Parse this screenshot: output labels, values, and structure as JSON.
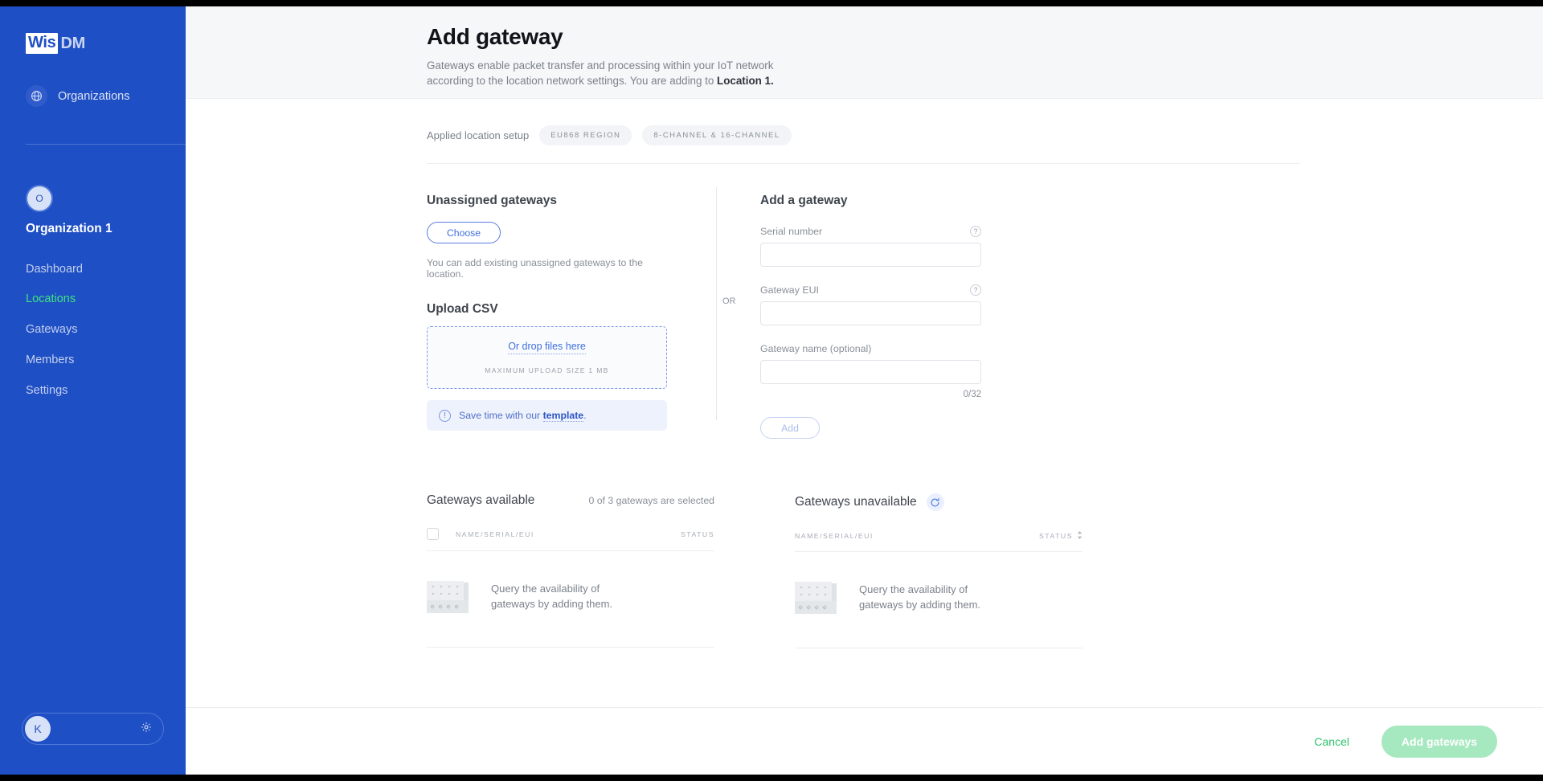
{
  "sidebar": {
    "logo_first": "Wis",
    "logo_second": "DM",
    "organizations_label": "Organizations",
    "org_avatar_initial": "O",
    "org_name": "Organization 1",
    "nav": [
      {
        "label": "Dashboard",
        "active": false
      },
      {
        "label": "Locations",
        "active": true
      },
      {
        "label": "Gateways",
        "active": false
      },
      {
        "label": "Members",
        "active": false
      },
      {
        "label": "Settings",
        "active": false
      }
    ],
    "user_initial": "K",
    "accent_blue": "#1f4fc4",
    "active_green": "#3ee37e"
  },
  "header": {
    "title": "Add gateway",
    "subtitle_part1": "Gateways enable packet transfer and processing within your IoT network according to the location network settings. You are adding to ",
    "subtitle_bold": "Location 1."
  },
  "setup": {
    "label": "Applied location setup",
    "chips": [
      "EU868 REGION",
      "8-CHANNEL & 16-CHANNEL"
    ]
  },
  "unassigned": {
    "title": "Unassigned gateways",
    "choose_label": "Choose",
    "help": "You can add existing unassigned gateways to the location.",
    "upload_title": "Upload CSV",
    "drop_link": "Or drop files here",
    "drop_max": "MAXIMUM UPLOAD SIZE 1 MB",
    "template_prefix": "Save time with our ",
    "template_link": "template",
    "template_suffix": "."
  },
  "divider": {
    "or_label": "OR"
  },
  "addform": {
    "title": "Add a gateway",
    "serial_label": "Serial number",
    "serial_value": "",
    "eui_label": "Gateway EUI",
    "eui_value": "",
    "name_label": "Gateway name (optional)",
    "name_value": "",
    "counter": "0/32",
    "add_label": "Add",
    "help_glyph": "?"
  },
  "available": {
    "title": "Gateways available",
    "selection": "0 of 3 gateways are selected",
    "col_name": "NAME/SERIAL/EUI",
    "col_status": "STATUS",
    "empty_text": "Query the availability of gateways by adding them."
  },
  "unavailable": {
    "title": "Gateways unavailable",
    "col_name": "NAME/SERIAL/EUI",
    "col_status": "STATUS",
    "empty_text": "Query the availability of gateways by adding them."
  },
  "footer": {
    "cancel_label": "Cancel",
    "submit_label": "Add gateways",
    "submit_color": "#a6e8bf"
  }
}
